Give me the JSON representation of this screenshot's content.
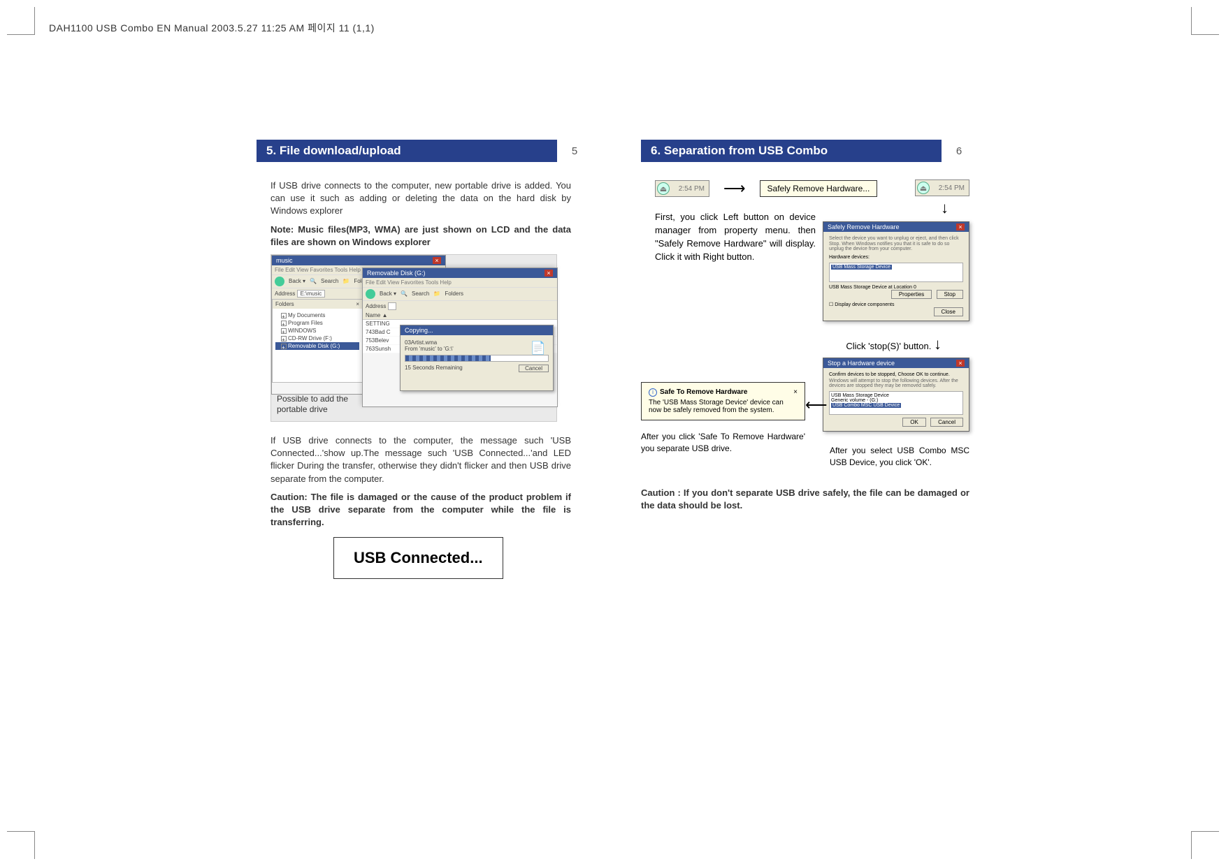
{
  "meta": {
    "header": "DAH1100 USB Combo EN Manual  2003.5.27 11:25 AM  페이지 11 (1,1)"
  },
  "left": {
    "title": "5. File download/upload",
    "page": "5",
    "p1": "If USB drive connects to the computer, new portable drive is added. You can use it such as adding or deleting the data on the hard disk by Windows explorer",
    "p1b": "Note: Music files(MP3, WMA) are just shown on LCD and the data files are shown on Windows explorer",
    "explorer": {
      "win1_title": "music",
      "menu": "File   Edit   View   Favorites   Tools   Help",
      "back": "Back  ▾",
      "search": "Search",
      "folders_btn": "Folders",
      "address_label": "Address",
      "address_value": "E:\\music",
      "folders_header": "Folders",
      "folder_items": [
        "My Documents",
        "Program Files",
        "WINDOWS",
        "CD-RW Drive (F:)",
        "Removable Disk (G:)"
      ],
      "win2_title": "Removable Disk (G:)",
      "file_name_col": "Name ▲",
      "files": [
        "SETTING",
        "743Bad C",
        "753Belev",
        "763Sunsh"
      ],
      "copy_title": "Copying...",
      "copy_file": "03Artist.wma",
      "copy_from": "From 'music' to 'G:\\'",
      "copy_remaining": "15 Seconds Remaining",
      "copy_cancel": "Cancel",
      "annotation": "Possible to add the portable drive"
    },
    "p2": "If USB drive connects to the computer, the message such 'USB Connected...'show up.The message such 'USB Connected...'and LED flicker During the transfer, otherwise they didn't flicker and then USB drive separate from the computer.",
    "p2b": "Caution: The file is damaged or the cause of the product problem if the USB drive separate from the computer while the file is transferring.",
    "usb_banner": "USB Connected..."
  },
  "right": {
    "title": "6. Separation from USB Combo",
    "page": "6",
    "tray_time": "2:54 PM",
    "tooltip": "Safely Remove Hardware...",
    "step1": "First, you click Left button on device manager from property menu. then \"Safely Remove Hardware\" will display. Click it with Right button.",
    "dlg1": {
      "title": "Safely Remove Hardware",
      "desc": "Select the device you want to unplug or eject, and then click Stop. When Windows notifies you that it is safe to do so unplug the device from your computer.",
      "hw_label": "Hardware devices:",
      "item": "USB Mass Storage Device",
      "sub": "USB Mass Storage Device at Location 0",
      "btn1": "Properties",
      "btn2": "Stop",
      "chk": "Display device components",
      "close": "Close"
    },
    "click_stop": "Click 'stop(S)' button.",
    "dlg2": {
      "title": "Stop a Hardware device",
      "desc": "Confirm devices to be stopped, Choose OK to continue.",
      "desc2": "Windows will attempt to stop the following devices. After the devices are stopped they may be removed safely.",
      "item1": "USB Mass Storage Device",
      "item2": "Generic volume - (G:)",
      "item3": "USB Combo MSC USB Device",
      "ok": "OK",
      "cancel": "Cancel"
    },
    "after_select": "After you select USB Combo MSC USB Device, you click 'OK'.",
    "balloon": {
      "title": "Safe To Remove Hardware",
      "body": "The 'USB Mass Storage Device' device can now be safely removed from the system."
    },
    "after_balloon": "After you click 'Safe To Remove Hardware'  you separate USB drive.",
    "caution": "Caution : If you don't separate USB drive safely, the file can be damaged or the data should be lost."
  }
}
